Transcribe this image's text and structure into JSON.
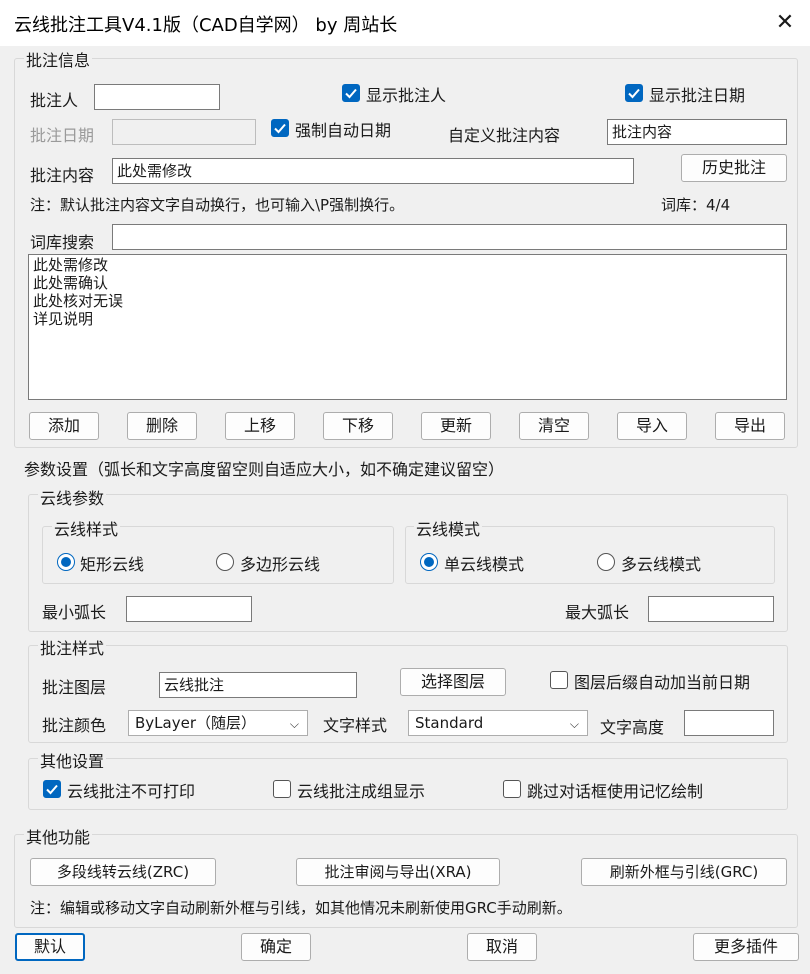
{
  "window": {
    "title": "云线批注工具V4.1版（CAD自学网） by 周站长",
    "close_glyph": "✕"
  },
  "annotation_info": {
    "legend": "批注信息",
    "annotator_label": "批注人",
    "annotator_value": "",
    "show_annotator_label": "显示批注人",
    "show_annotator_checked": true,
    "show_date_label": "显示批注日期",
    "show_date_checked": true,
    "date_label": "批注日期",
    "date_value": "",
    "force_auto_date_label": "强制自动日期",
    "force_auto_date_checked": true,
    "custom_content_label": "自定义批注内容",
    "custom_content_value": "批注内容",
    "content_label": "批注内容",
    "content_value": "此处需修改",
    "history_button": "历史批注",
    "note": "注：默认批注内容文字自动换行，也可输入\\P强制换行。",
    "library_count": "词库：4/4",
    "search_label": "词库搜索",
    "search_value": "",
    "library_items": [
      "此处需修改",
      "此处需确认",
      "此处核对无误",
      "详见说明"
    ],
    "buttons": [
      "添加",
      "删除",
      "上移",
      "下移",
      "更新",
      "清空",
      "导入",
      "导出"
    ]
  },
  "parameters": {
    "legend": "参数设置（弧长和文字高度留空则自适应大小，如不确定建议留空）",
    "cloud_params_legend": "云线参数",
    "cloud_style_legend": "云线样式",
    "style_rect": "矩形云线",
    "style_poly": "多边形云线",
    "style_selected": "rect",
    "cloud_mode_legend": "云线模式",
    "mode_single": "单云线模式",
    "mode_multi": "多云线模式",
    "mode_selected": "single",
    "min_arc_label": "最小弧长",
    "min_arc_value": "",
    "max_arc_label": "最大弧长",
    "max_arc_value": "",
    "annotation_style_legend": "批注样式",
    "layer_label": "批注图层",
    "layer_value": "云线批注",
    "select_layer_button": "选择图层",
    "layer_date_suffix_label": "图层后缀自动加当前日期",
    "layer_date_suffix_checked": false,
    "color_label": "批注颜色",
    "color_value": "ByLayer（随层）",
    "text_style_label": "文字样式",
    "text_style_value": "Standard",
    "text_height_label": "文字高度",
    "text_height_value": "",
    "other_settings_legend": "其他设置",
    "no_print_label": "云线批注不可打印",
    "no_print_checked": true,
    "group_display_label": "云线批注成组显示",
    "group_display_checked": false,
    "skip_dialog_label": "跳过对话框使用记忆绘制",
    "skip_dialog_checked": false
  },
  "other_functions": {
    "legend": "其他功能",
    "buttons": [
      "多段线转云线(ZRC)",
      "批注审阅与导出(XRA)",
      "刷新外框与引线(GRC)"
    ],
    "note": "注：编辑或移动文字自动刷新外框与引线，如其他情况未刷新使用GRC手动刷新。"
  },
  "footer": {
    "default": "默认",
    "ok": "确定",
    "cancel": "取消",
    "more_plugins": "更多插件"
  },
  "colors": {
    "accent": "#0067c0",
    "background": "#f0f0f0"
  }
}
